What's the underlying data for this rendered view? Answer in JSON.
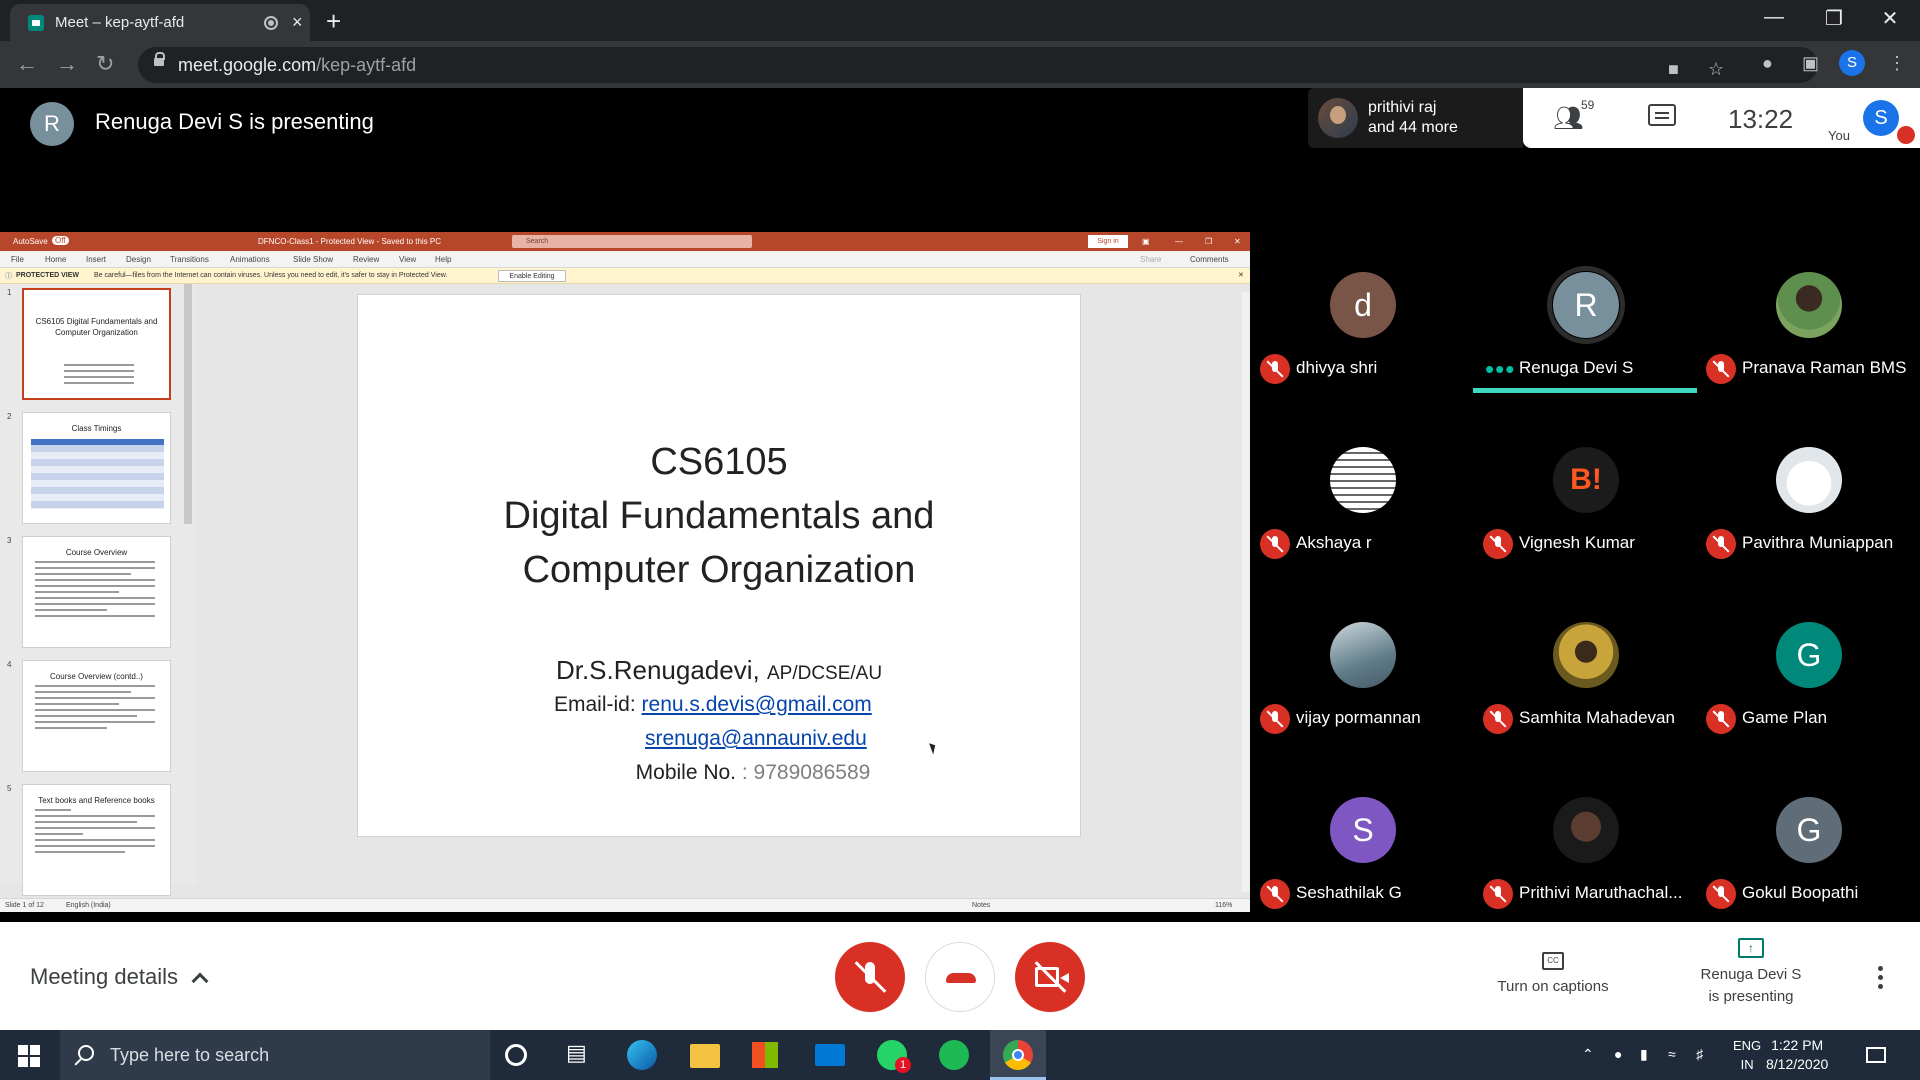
{
  "browser": {
    "tab_title": "Meet – kep-aytf-afd",
    "url_host": "meet.google.com",
    "url_path": "/kep-aytf-afd",
    "profile_initial": "S",
    "new_tab": "+",
    "tab_close": "×"
  },
  "meet_header": {
    "presenter_initial": "R",
    "presenter_label": "Renuga Devi S is presenting",
    "joiners_line1": "prithivi raj",
    "joiners_line2": "and 44 more",
    "people_count": "59",
    "time": "13:22",
    "you_label": "You",
    "you_initial": "S"
  },
  "ppt": {
    "autosave": "AutoSave",
    "autosave_state": "Off",
    "doc_title": "DFNCO-Class1 - Protected View - Saved to this PC",
    "search": "Search",
    "sign_in": "Sign in",
    "tabs": [
      "File",
      "Home",
      "Insert",
      "Design",
      "Transitions",
      "Animations",
      "Slide Show",
      "Review",
      "View",
      "Help"
    ],
    "share": "Share",
    "comments": "Comments",
    "protected_label": "PROTECTED VIEW",
    "protected_msg": "Be careful—files from the Internet can contain viruses. Unless you need to edit, it's safer to stay in Protected View.",
    "enable_editing": "Enable Editing",
    "thumbnails": [
      {
        "num": "1",
        "title": "CS6105 Digital Fundamentals and Computer Organization"
      },
      {
        "num": "2",
        "title": "Class Timings"
      },
      {
        "num": "3",
        "title": "Course Overview"
      },
      {
        "num": "4",
        "title": "Course Overview (contd..)"
      },
      {
        "num": "5",
        "title": "Text books and Reference books"
      }
    ],
    "slide": {
      "title_line1": "CS6105",
      "title_line2": "Digital Fundamentals and",
      "title_line3": "Computer Organization",
      "name": "Dr.S.Renugadevi,",
      "affiliation": "AP/DCSE/AU",
      "email_label": "Email-id",
      "email1": "renu.s.devis@gmail.com",
      "email2": "srenuga@annauniv.edu",
      "mobile_label": "Mobile No.",
      "mobile": ": 9789086589"
    },
    "status_slide": "Slide 1 of 12",
    "status_lang": "English (India)",
    "status_notes": "Notes",
    "status_zoom": "116%"
  },
  "participants": [
    {
      "name": "dhivya shri",
      "initial": "d",
      "color": "#795548",
      "muted": true
    },
    {
      "name": "Renuga Devi S",
      "initial": "R",
      "color": "#78909c",
      "muted": false,
      "speaking": true
    },
    {
      "name": "Pranava Raman BMS",
      "initial": "",
      "color": "#6a8f4e",
      "muted": true
    },
    {
      "name": "Akshaya r",
      "initial": "",
      "color": "#eeeeee",
      "muted": true
    },
    {
      "name": "Vignesh Kumar",
      "initial": "B!",
      "color": "#1b1b1b",
      "muted": true
    },
    {
      "name": "Pavithra Muniappan",
      "initial": "",
      "color": "#f2f4f6",
      "muted": true
    },
    {
      "name": "vijay pormannan",
      "initial": "",
      "color": "#8aa6b8",
      "muted": true
    },
    {
      "name": "Samhita Mahadevan",
      "initial": "",
      "color": "#8c6d1f",
      "muted": true
    },
    {
      "name": "Game Plan",
      "initial": "G",
      "color": "#00897b",
      "muted": true
    },
    {
      "name": "Seshathilak G",
      "initial": "S",
      "color": "#7e57c2",
      "muted": true
    },
    {
      "name": "Prithivi Maruthachal...",
      "initial": "",
      "color": "#3a2d2a",
      "muted": true
    },
    {
      "name": "Gokul Boopathi",
      "initial": "G",
      "color": "#5f6d78",
      "muted": true
    }
  ],
  "meet_controls": {
    "details": "Meeting details",
    "captions": "Turn on captions",
    "presenting_line1": "Renuga Devi S",
    "presenting_line2": "is presenting"
  },
  "taskbar": {
    "search_placeholder": "Type here to search",
    "whatsapp_badge": "1",
    "lang1": "ENG",
    "lang2": "IN",
    "time": "1:22 PM",
    "date": "8/12/2020"
  }
}
